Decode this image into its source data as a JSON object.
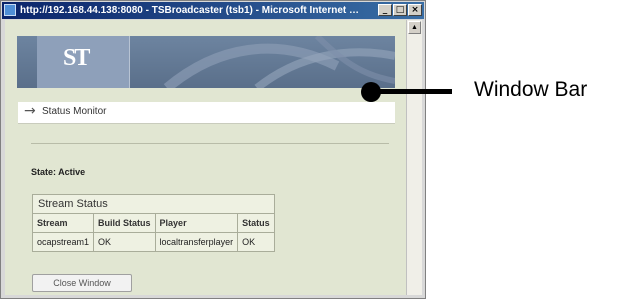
{
  "window": {
    "title": "http://192.168.44.138:8080 - TSBroadcaster (tsb1) - Microsoft Internet Ex...",
    "minimize_glyph": "_",
    "maximize_glyph": "□",
    "close_glyph": "×"
  },
  "banner": {
    "logo_text": "ST"
  },
  "status_monitor": {
    "arrow": "→",
    "label": "Status Monitor"
  },
  "state": {
    "text": "State: Active"
  },
  "stream_status": {
    "caption": "Stream Status",
    "columns": [
      "Stream",
      "Build Status",
      "Player",
      "Status"
    ],
    "rows": [
      [
        "ocapstream1",
        "OK",
        "localtransferplayer",
        "OK"
      ]
    ]
  },
  "buttons": {
    "close_window": "Close Window"
  },
  "annotation": {
    "label": "Window Bar"
  },
  "colors": {
    "title_bar": "#0a246a",
    "client_bg": "#e1e6d2",
    "banner": "#6d84a0"
  },
  "icons": {
    "ie": "ie-page-icon",
    "scroll_up": "scroll-up-arrow-icon",
    "arrow": "right-arrow-icon"
  }
}
